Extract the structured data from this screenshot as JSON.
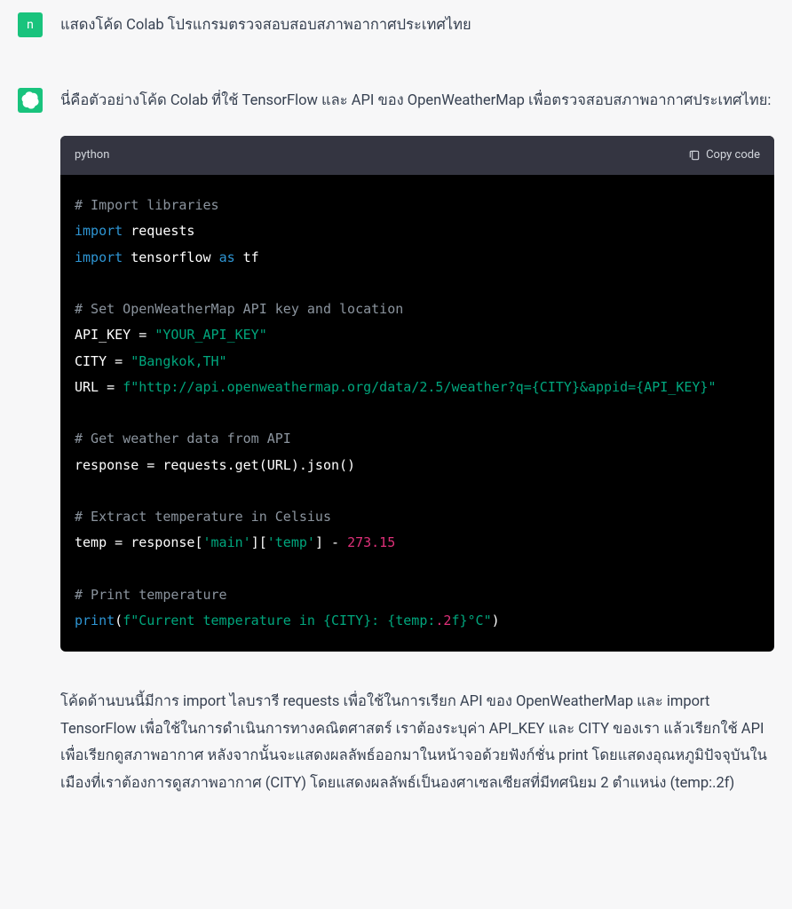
{
  "user": {
    "avatar_letter": "n",
    "message": "แสดงโค้ด Colab โปรแกรมตรวจสอบสอบสภาพอากาศประเทศไทย"
  },
  "assistant": {
    "intro": "นี่คือตัวอย่างโค้ด Colab ที่ใช้ TensorFlow และ API ของ OpenWeatherMap เพื่อตรวจสอบสภาพอากาศประเทศไทย:",
    "code_lang": "python",
    "copy_label": "Copy code",
    "explanation": "โค้ดด้านบนนี้มีการ import ไลบรารี requests เพื่อใช้ในการเรียก API ของ OpenWeatherMap และ import TensorFlow เพื่อใช้ในการดำเนินการทางคณิตศาสตร์ เราต้องระบุค่า API_KEY และ CITY ของเรา แล้วเรียกใช้ API เพื่อเรียกดูสภาพอากาศ หลังจากนั้นจะแสดงผลลัพธ์ออกมาในหน้าจอด้วยฟังก์ชั่น print โดยแสดงอุณหภูมิปัจจุบันในเมืองที่เราต้องการดูสภาพอากาศ (CITY) โดยแสดงผลลัพธ์เป็นองศาเซลเซียสที่มีทศนิยม 2 ตำแหน่ง (temp:.2f)"
  },
  "code": {
    "c1": "# Import libraries",
    "kw_import1": "import",
    "id_requests": " requests",
    "kw_import2": "import",
    "id_tf": " tensorflow ",
    "kw_as": "as",
    "id_tfalias": " tf",
    "c2": "# Set OpenWeatherMap API key and location",
    "apikey_lhs": "API_KEY = ",
    "apikey_val": "\"YOUR_API_KEY\"",
    "city_lhs": "CITY = ",
    "city_val": "\"Bangkok,TH\"",
    "url_lhs": "URL = ",
    "url_f": "f\"http://api.openweathermap.org/data/2.5/weather?q=",
    "url_city": "{CITY}",
    "url_mid": "&appid=",
    "url_key": "{API_KEY}",
    "url_end": "\"",
    "c3": "# Get weather data from API",
    "resp_line": "response = requests.get(URL).json()",
    "c4": "# Extract temperature in Celsius",
    "temp_lhs": "temp = response[",
    "temp_main": "'main'",
    "temp_mid": "][",
    "temp_temp": "'temp'",
    "temp_rhs": "] - ",
    "temp_num": "273.15",
    "c5": "# Print temperature",
    "print_fn": "print",
    "print_open": "(",
    "print_f1": "f\"Current temperature in ",
    "print_city": "{CITY}",
    "print_mid": ": ",
    "print_temp": "{temp:",
    "print_fmt": ".2",
    "print_f2": "f}",
    "print_deg": "°C\"",
    "print_close": ")"
  }
}
